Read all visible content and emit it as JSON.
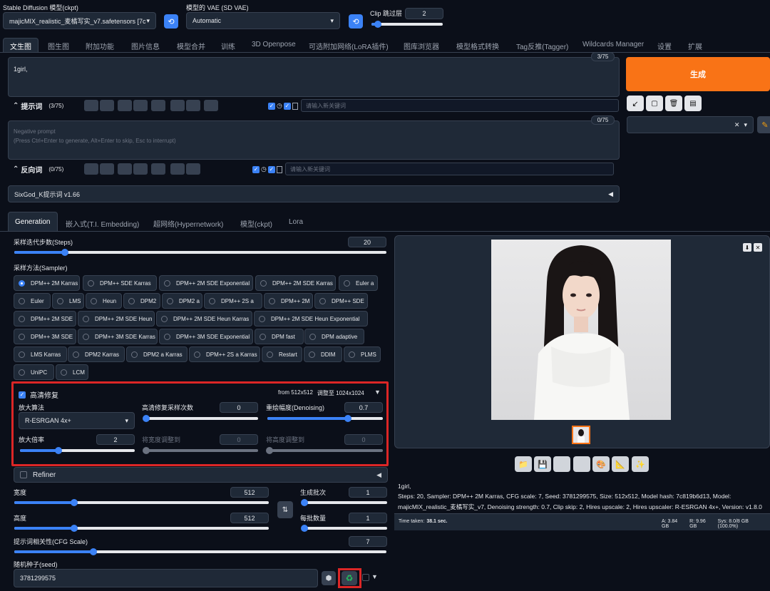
{
  "top": {
    "ckpt_label": "Stable Diffusion 模型(ckpt)",
    "ckpt_value": "majicMIX_realistic_麦橘写实_v7.safetensors [7c",
    "vae_label": "模型的 VAE (SD VAE)",
    "vae_value": "Automatic",
    "clip_label": "Clip 跳过层",
    "clip_value": "2"
  },
  "tabs": [
    "文生图",
    "图生图",
    "附加功能",
    "图片信息",
    "模型合并",
    "训练",
    "3D Openpose",
    "可选附加网络(LoRA插件)",
    "图库浏览器",
    "模型格式转换",
    "Tag反推(Tagger)",
    "Wildcards Manager",
    "设置",
    "扩展"
  ],
  "prompt": {
    "text": "1girl,",
    "counter": "3/75",
    "label": "提示词",
    "count": "(3/75)",
    "keyword_placeholder": "请输入新关键词"
  },
  "negative": {
    "placeholder_line1": "Negative prompt",
    "placeholder_line2": "(Press Ctrl+Enter to generate, Alt+Enter to skip, Esc to interrupt)",
    "counter": "0/75",
    "label": "反向词",
    "count": "(0/75)",
    "keyword_placeholder": "请输入新关键词"
  },
  "generate_label": "生成",
  "sixgod_label": "SixGod_K提示词 v1.66",
  "subtabs": [
    "Generation",
    "嵌入式(T.I. Embedding)",
    "超网络(Hypernetwork)",
    "模型(ckpt)",
    "Lora"
  ],
  "steps": {
    "label": "采样迭代步数(Steps)",
    "value": "20",
    "fraction": 0.13
  },
  "sampler": {
    "label": "采样方法(Sampler)",
    "options": [
      "DPM++ 2M Karras",
      "DPM++ SDE Karras",
      "DPM++ 2M SDE Exponential",
      "DPM++ 2M SDE Karras",
      "Euler a",
      "Euler",
      "LMS",
      "Heun",
      "DPM2",
      "DPM2 a",
      "DPM++ 2S a",
      "DPM++ 2M",
      "DPM++ SDE",
      "DPM++ 2M SDE",
      "DPM++ 2M SDE Heun",
      "DPM++ 2M SDE Heun Karras",
      "DPM++ 2M SDE Heun Exponential",
      "DPM++ 3M SDE",
      "DPM++ 3M SDE Karras",
      "DPM++ 3M SDE Exponential",
      "DPM fast",
      "DPM adaptive",
      "LMS Karras",
      "DPM2 Karras",
      "DPM2 a Karras",
      "DPM++ 2S a Karras",
      "Restart",
      "DDIM",
      "PLMS",
      "UniPC",
      "LCM"
    ]
  },
  "hires": {
    "label": "高清修复",
    "summary_from": "from 512x512",
    "summary_to": "调整至 1024x1024",
    "upscaler_label": "放大算法",
    "upscaler_value": "R-ESRGAN 4x+",
    "steps_label": "高清修复采样次数",
    "steps_value": "0",
    "denoise_label": "重绘幅度(Denoising)",
    "denoise_value": "0.7",
    "scale_label": "放大倍率",
    "scale_value": "2",
    "width_label": "将宽度调整到",
    "width_value": "0",
    "height_label": "将高度调整到",
    "height_value": "0"
  },
  "refiner_label": "Refiner",
  "size": {
    "width_label": "宽度",
    "width_value": "512",
    "height_label": "高度",
    "height_value": "512",
    "batch_count_label": "生成批次",
    "batch_count_value": "1",
    "batch_size_label": "每批数量",
    "batch_size_value": "1"
  },
  "cfg": {
    "label": "提示词相关性(CFG Scale)",
    "value": "7"
  },
  "seed": {
    "label": "随机种子(seed)",
    "value": "3781299575"
  },
  "output": {
    "info_line1": "1girl,",
    "info_line2": "Steps: 20, Sampler: DPM++ 2M Karras, CFG scale: 7, Seed: 3781299575, Size: 512x512, Model hash: 7c819b6d13, Model:",
    "info_line3": "majicMIX_realistic_麦橘写实_v7, Denoising strength: 0.7, Clip skip: 2, Hires upscale: 2, Hires upscaler: R-ESRGAN 4x+, Version: v1.8.0",
    "time_label": "Time taken:",
    "time_value": "38.1 sec.",
    "vram_a": "A: 3.84 GB",
    "vram_r": "R: 9.96 GB",
    "vram_sys": "Sys: 8.0/8 GB (100.0%)"
  },
  "colors": {
    "accent": "#f97316",
    "highlight_box": "#dc2626",
    "primary": "#3b82f6"
  }
}
